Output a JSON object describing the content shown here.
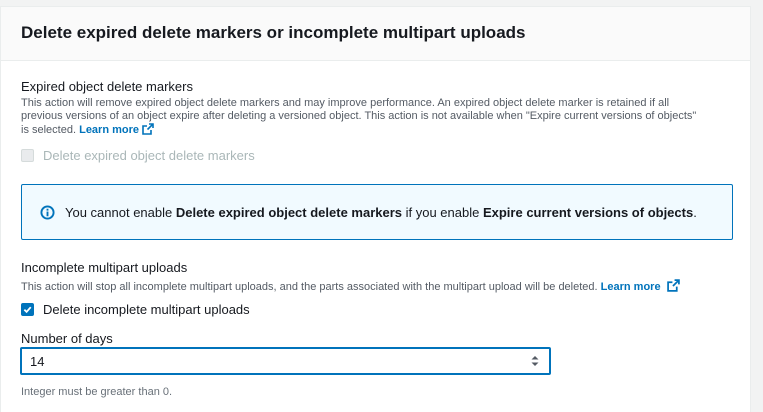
{
  "panel": {
    "title": "Delete expired delete markers or incomplete multipart uploads"
  },
  "expired_markers": {
    "label": "Expired object delete markers",
    "description_line1": "This action will remove expired object delete markers and may improve performance. An expired object delete marker is retained if all",
    "description_line2": "previous versions of an object expire after deleting a versioned object. This action is not available when \"Expire current versions of objects\"",
    "description_line3": "is selected.",
    "learn_more": "Learn more",
    "checkbox_label": "Delete expired object delete markers",
    "checkbox_checked": false,
    "checkbox_disabled": true
  },
  "info_alert": {
    "text_pre": "You cannot enable ",
    "text_bold1": "Delete expired object delete markers",
    "text_mid": " if you enable ",
    "text_bold2": "Expire current versions of objects",
    "text_post": "."
  },
  "multipart": {
    "label": "Incomplete multipart uploads",
    "description": "This action will stop all incomplete multipart uploads, and the parts associated with the multipart upload will be deleted.",
    "learn_more": "Learn more",
    "checkbox_label": "Delete incomplete multipart uploads",
    "checkbox_checked": true
  },
  "days_field": {
    "label": "Number of days",
    "value": "14",
    "hint": "Integer must be greater than 0."
  },
  "colors": {
    "link": "#0073bb",
    "alert_bg": "#f1faff",
    "alert_border": "#0073bb",
    "text": "#16191f",
    "muted": "#545b64"
  }
}
